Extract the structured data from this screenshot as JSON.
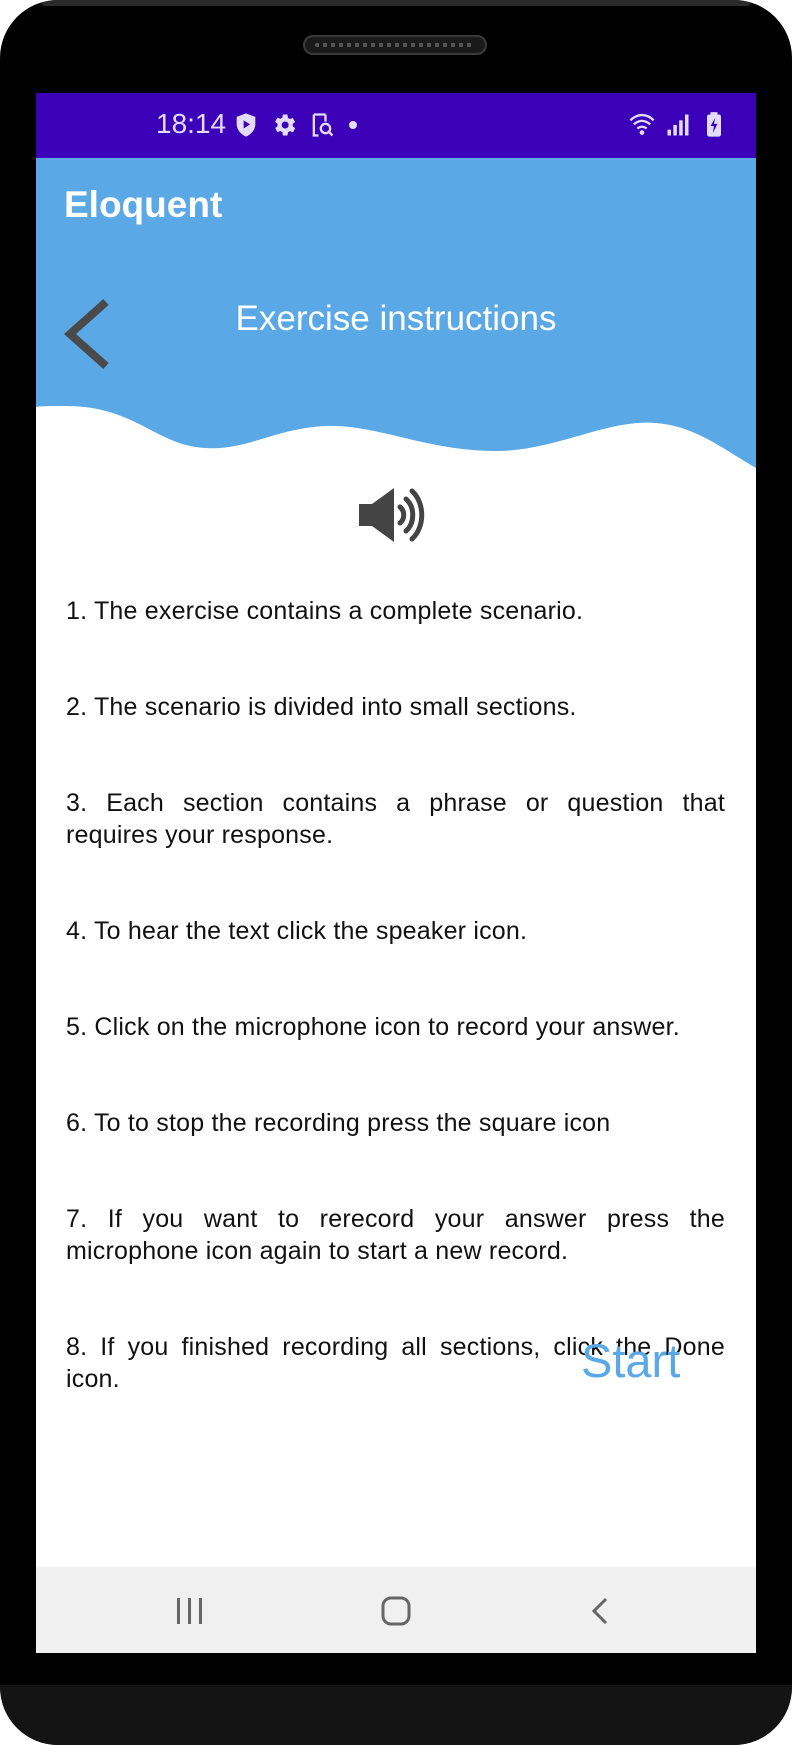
{
  "status_bar": {
    "time": "18:14",
    "left_icons": [
      "shield-play-icon",
      "gear-icon",
      "screen-search-icon",
      "dot-icon"
    ],
    "right_icons": [
      "wifi-icon",
      "cellular-signal-icon",
      "battery-charging-icon"
    ],
    "background": "#3b00b7"
  },
  "app_bar": {
    "title": "Eloquent",
    "background": "#5aa8e6"
  },
  "header": {
    "title": "Exercise instructions",
    "back_icon": "chevron-left-icon"
  },
  "speaker": {
    "icon": "speaker-icon"
  },
  "instructions": [
    "1. The exercise contains a complete scenario.",
    "2. The scenario is divided into small sections.",
    "3. Each section contains a phrase or question that requires your response.",
    "4. To hear the text click the speaker icon.",
    "5. Click on the microphone icon to record your answer.",
    "6. To to stop the recording press the square icon",
    "7. If you want to rerecord your answer press the microphone icon again to start a new record.",
    "8. If you finished recording all sections, click the Done icon."
  ],
  "start_button": {
    "label": "Start",
    "color": "#5aa8e6"
  },
  "nav_bar": {
    "icons": [
      "recent-apps-icon",
      "home-icon",
      "back-icon"
    ]
  }
}
